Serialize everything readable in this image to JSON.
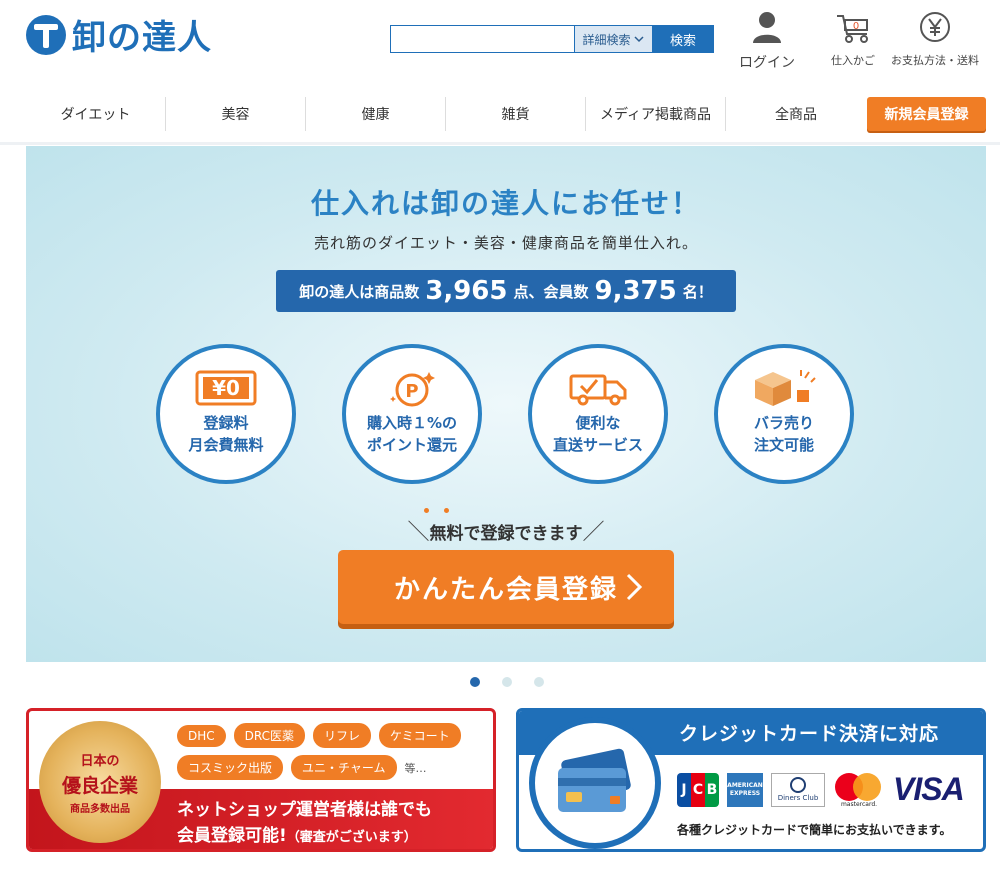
{
  "header": {
    "logo_text": "卸の達人",
    "search_placeholder": "",
    "advanced_search_label": "詳細検索",
    "search_button_label": "検索",
    "login_label": "ログイン",
    "cart_label": "仕入かご",
    "cart_count": "0",
    "payment_label": "お支払方法・送料"
  },
  "nav": {
    "items": [
      "ダイエット",
      "美容",
      "健康",
      "雑貨",
      "メディア掲載商品",
      "全商品"
    ],
    "signup_label": "新規会員登録"
  },
  "hero": {
    "title": "仕入れは卸の達人にお任せ！",
    "subtitle": "売れ筋のダイエット・美容・健康商品を簡単仕入れ。",
    "stat_prefix": "卸の達人は商品数",
    "product_count": "3,965",
    "stat_mid": "点、会員数",
    "member_count": "9,375",
    "stat_suffix": "名！",
    "features": [
      {
        "line1": "登録料",
        "line2": "月会費無料",
        "icon": "yen-zero-icon"
      },
      {
        "line1": "購入時１%の",
        "line2": "ポイント還元",
        "icon": "point-icon"
      },
      {
        "line1": "便利な",
        "line2": "直送サービス",
        "icon": "truck-icon"
      },
      {
        "line1": "バラ売り",
        "line2": "注文可能",
        "icon": "box-icon"
      }
    ],
    "free_text": "無料で登録できます",
    "cta_label": "かんたん会員登録"
  },
  "pager": {
    "count": 3,
    "active": 0
  },
  "banner_left": {
    "medal_line1": "日本の",
    "medal_line2": "優良企業",
    "medal_line3": "商品多数出品",
    "brands": [
      "DHC",
      "DRC医薬",
      "リフレ",
      "ケミコート",
      "コスミック出版",
      "ユニ・チャーム"
    ],
    "brands_more": "等…",
    "text_line1": "ネットショップ運営者様は誰でも",
    "text_line2": "会員登録可能!",
    "text_note": "（審査がございます）"
  },
  "banner_right": {
    "title": "クレジットカード決済に対応",
    "brands": [
      "JCB",
      "AMERICAN EXPRESS",
      "Diners Club INTERNATIONAL",
      "mastercard",
      "VISA"
    ],
    "footer": "各種クレジットカードで簡単にお支払いできます。"
  },
  "colors": {
    "brand_blue": "#1f6fb8",
    "accent_orange": "#f07d25",
    "banner_red": "#d52128"
  }
}
